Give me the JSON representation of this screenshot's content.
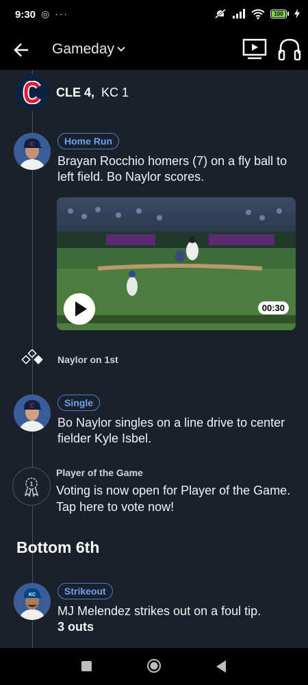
{
  "status_bar": {
    "time": "9:30",
    "left_icons": "◎ ···",
    "battery": "100"
  },
  "app_bar": {
    "title": "Gameday",
    "title_icon": "chevron-down-icon"
  },
  "score": {
    "home_label": "CLE 4,",
    "away_label": "KC 1"
  },
  "events": [
    {
      "badge": "Home Run",
      "text": "Brayan Rocchio homers (7) on a fly ball to left field. Bo Naylor scores.",
      "video_duration": "00:30"
    },
    {
      "runner_text": "Naylor on 1st"
    },
    {
      "badge": "Single",
      "text": "Bo Naylor singles on a line drive to center fielder Kyle Isbel."
    },
    {
      "label": "Player of the Game",
      "text": "Voting is now open for Player of the Game. Tap here to vote now!"
    }
  ],
  "section": {
    "heading": "Bottom 6th"
  },
  "strikeout": {
    "badge": "Strikeout",
    "text": "MJ Melendez strikes out on a foul tip.",
    "outs": "3 outs"
  },
  "colors": {
    "background": "#1b212b",
    "accent_blue": "#6ea0f5",
    "cle_navy": "#0c2340",
    "cle_red": "#e31937"
  }
}
